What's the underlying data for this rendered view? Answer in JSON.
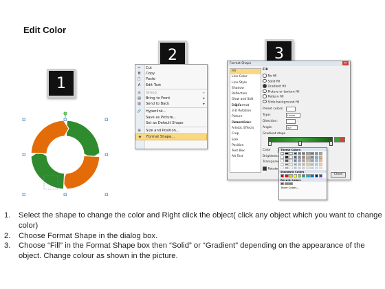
{
  "title": "Edit Color",
  "badges": [
    "1",
    "2",
    "3"
  ],
  "context_menu": {
    "items": [
      {
        "label": "Cut",
        "icon": "scissors-icon",
        "glyph": "✂"
      },
      {
        "label": "Copy",
        "icon": "copy-icon",
        "glyph": "⧉"
      },
      {
        "label": "Paste",
        "icon": "paste-icon",
        "glyph": "📋"
      },
      {
        "label": "Edit Text",
        "icon": "edit-text-icon",
        "glyph": "A"
      },
      {
        "label": "Group",
        "icon": "group-icon",
        "glyph": "▣",
        "disabled": true,
        "submenu": true
      },
      {
        "label": "Bring to Front",
        "icon": "bring-front-icon",
        "glyph": "▤",
        "submenu": true
      },
      {
        "label": "Send to Back",
        "icon": "send-back-icon",
        "glyph": "▥",
        "submenu": true
      },
      {
        "label": "Hyperlink...",
        "icon": "hyperlink-icon",
        "glyph": "🔗"
      },
      {
        "label": "Save as Picture...",
        "icon": "",
        "glyph": ""
      },
      {
        "label": "Set as Default Shape",
        "icon": "",
        "glyph": ""
      },
      {
        "label": "Size and Position...",
        "icon": "size-position-icon",
        "glyph": "⊞"
      },
      {
        "label": "Format Shape...",
        "icon": "format-shape-icon",
        "glyph": "◈",
        "highlighted": true
      }
    ]
  },
  "dialog": {
    "title": "Format Shape",
    "sidebar": [
      "Fill",
      "Line Color",
      "Line Style",
      "Shadow",
      "Reflection",
      "Glow and Soft Edges",
      "3-D Format",
      "3-D Rotation",
      "Picture Corrections",
      "Picture Color",
      "Artistic Effects",
      "Crop",
      "Size",
      "Position",
      "Text Box",
      "Alt Text"
    ],
    "fill_header": "Fill",
    "options": [
      "No fill",
      "Solid fill",
      "Gradient fill",
      "Picture or texture fill",
      "Pattern fill",
      "Slide background fill"
    ],
    "preset_colors_label": "Preset colors:",
    "type_label": "Type:",
    "type_value": "Linear",
    "direction_label": "Direction:",
    "angle_label": "Angle:",
    "angle_value": "90°",
    "gradient_stops_label": "Gradient stops",
    "color_label": "Color",
    "position_label": "Position:",
    "position_value": "0%",
    "brightness_label": "Brightness:",
    "transparency_label": "Transparency:",
    "rotate_label": "Rotate with shape",
    "close_button": "Close",
    "palette": {
      "theme_header": "Theme Colors",
      "standard_header": "Standard Colors",
      "recent_header": "Recent Colors",
      "more": "More Colors...",
      "theme_top": [
        "#ffffff",
        "#000000",
        "#eeece1",
        "#1f497d",
        "#4f81bd",
        "#c0504d",
        "#9bbb59",
        "#8064a2",
        "#4bacc6",
        "#f79646"
      ],
      "standard": [
        "#c00000",
        "#ff0000",
        "#ffc000",
        "#ffff00",
        "#92d050",
        "#00b050",
        "#00b0f0",
        "#0070c0",
        "#002060",
        "#7030a0"
      ],
      "recent": [
        "#1f7a1f",
        "#e36c09",
        "#3aa53a"
      ]
    }
  },
  "ring_colors": {
    "orange": "#e36c09",
    "green": "#2e8b2e",
    "dark_green": "#1f6f1f",
    "dark_orange": "#b8560a"
  },
  "steps": [
    {
      "num": "1.",
      "text": "Select the shape to change the color and Right click the object( click any object which you want to change color)"
    },
    {
      "num": "2.",
      "text": "Choose Format Shape in the dialog box."
    },
    {
      "num": "3.",
      "text": "Choose “Fill” in the Format Shape box then “Solid” or “Gradient” depending on the appearance of the object. Change colour as shown in the picture."
    }
  ]
}
